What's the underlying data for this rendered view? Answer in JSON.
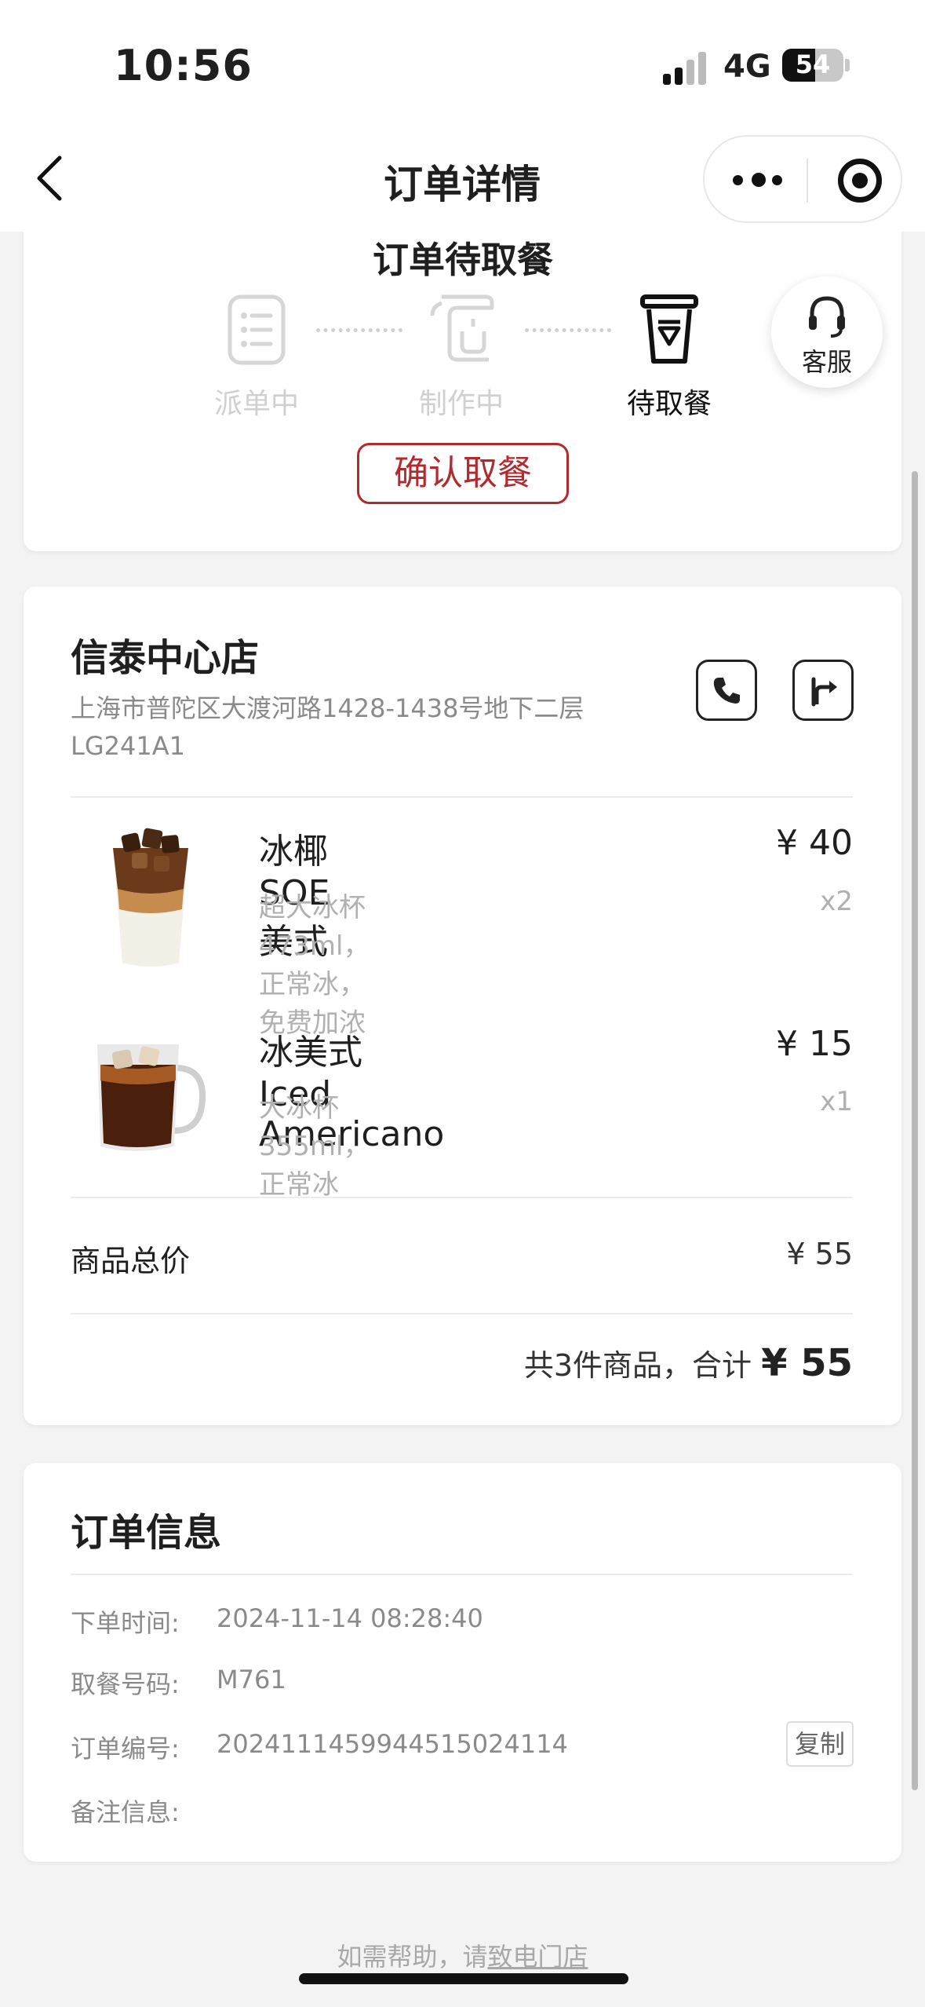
{
  "status_bar": {
    "time": "10:56",
    "network": "4G",
    "battery": "54"
  },
  "nav": {
    "title": "订单详情"
  },
  "order_status": {
    "title": "订单待取餐",
    "steps": [
      {
        "label": "派单中",
        "state": "done"
      },
      {
        "label": "制作中",
        "state": "done"
      },
      {
        "label": "待取餐",
        "state": "active"
      }
    ],
    "confirm_button": "确认取餐",
    "customer_service_label": "客服"
  },
  "store": {
    "name": "信泰中心店",
    "address": "上海市普陀区大渡河路1428-1438号地下二层LG241A1",
    "call_icon": "phone-icon",
    "nav_icon": "directions-icon"
  },
  "products": [
    {
      "name": "冰椰SOE美式",
      "spec": "超大冰杯 473ml，正常冰，免费加浓",
      "price": "¥ 40",
      "qty": "x2"
    },
    {
      "name": "冰美式 Iced Americano",
      "spec": "大冰杯 355ml，正常冰",
      "price": "¥ 15",
      "qty": "x1"
    }
  ],
  "summary": {
    "subtotal_label": "商品总价",
    "subtotal_value": "¥ 55",
    "total_prefix": "共3件商品，合计",
    "total_value": "¥ 55"
  },
  "order_info": {
    "title": "订单信息",
    "rows": [
      {
        "label": "下单时间:",
        "value": "2024-11-14 08:28:40"
      },
      {
        "label": "取餐号码:",
        "value": "M761"
      },
      {
        "label": "订单编号:",
        "value": "2024111459944515024114"
      },
      {
        "label": "备注信息:",
        "value": ""
      }
    ],
    "copy_button": "复制"
  },
  "footer": {
    "help_prefix": "如需帮助，请",
    "help_link": "致电门店"
  },
  "colors": {
    "accent": "#b3292e",
    "background": "#f3f3f3",
    "muted": "#8a8a8a"
  }
}
